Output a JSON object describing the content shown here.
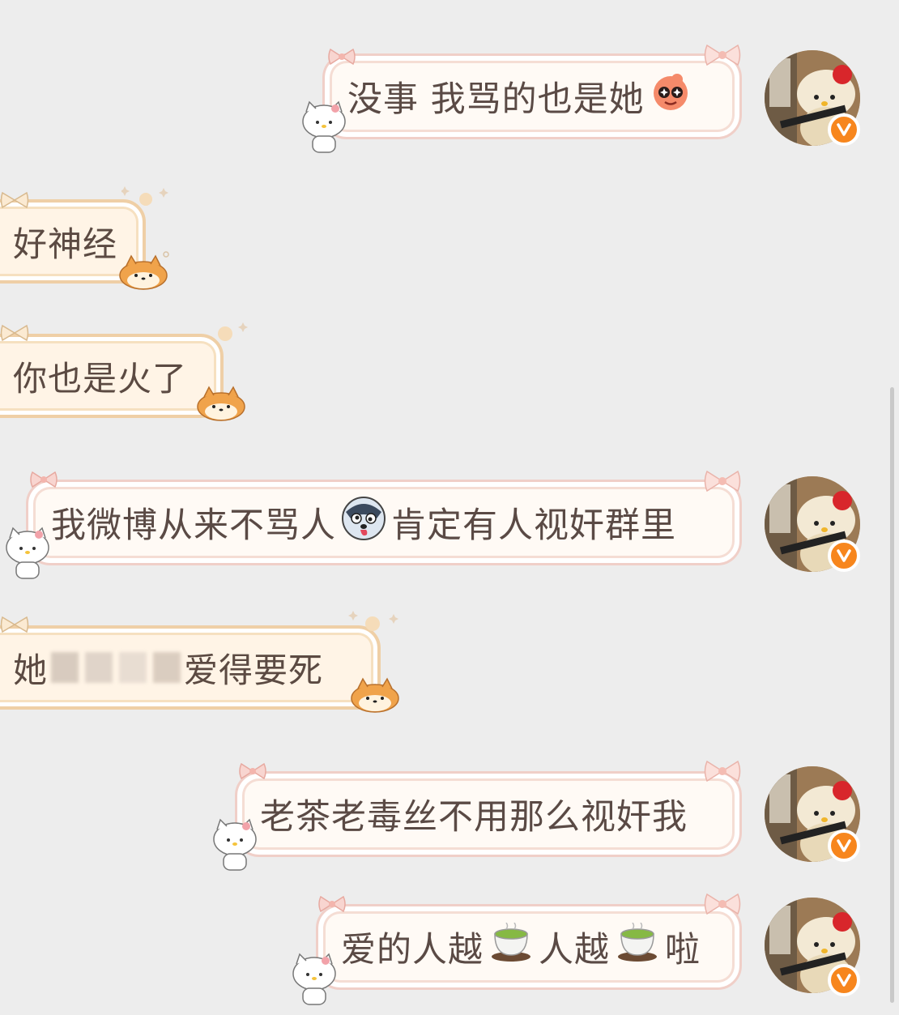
{
  "messages": [
    {
      "side": "sent",
      "text_before": "没事 我骂的也是她",
      "emoji_after": "starry-eyed-emoji",
      "verified": true
    },
    {
      "side": "received",
      "text": "好神经"
    },
    {
      "side": "received",
      "text": "你也是火了"
    },
    {
      "side": "sent",
      "text_before": "我微博从来不骂人",
      "emoji_mid": "husky-dog-emoji",
      "text_after": "肯定有人视奸群里",
      "verified": true
    },
    {
      "side": "received",
      "text_before": "她",
      "text_after": "爱得要死",
      "redacted": true
    },
    {
      "side": "sent",
      "text_before": "老茶老毒丝不用那么视奸我",
      "verified": true
    },
    {
      "side": "sent",
      "text_a": "爱的人越",
      "emoji_1": "tea-cup-emoji",
      "text_b": "人越",
      "emoji_2": "tea-cup-emoji",
      "text_c": "啦",
      "verified": true
    }
  ],
  "colors": {
    "background": "#ededed",
    "sent_bubble": "#fffaf5",
    "sent_border": "#f0cfc8",
    "received_bubble": "#fff4e6",
    "received_border": "#efcfa6",
    "verified_badge": "#f7861d"
  }
}
